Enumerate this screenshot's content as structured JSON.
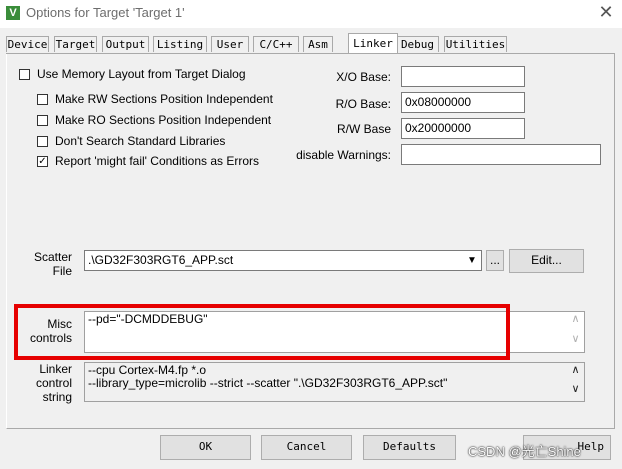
{
  "window": {
    "title": "Options for Target 'Target 1'",
    "icon": "keil-app-icon",
    "close_glyph": "✕"
  },
  "tabs": [
    "Device",
    "Target",
    "Output",
    "Listing",
    "User",
    "C/C++",
    "Asm",
    "Linker",
    "Debug",
    "Utilities"
  ],
  "active_tab": "Linker",
  "options": {
    "use_memory_layout": {
      "label": "Use Memory Layout from Target Dialog",
      "checked": false
    },
    "rw_position_independent": {
      "label": "Make RW Sections Position Independent",
      "checked": false
    },
    "ro_position_independent": {
      "label": "Make RO Sections Position Independent",
      "checked": false
    },
    "dont_search_std_libs": {
      "label": "Don't Search Standard Libraries",
      "checked": false
    },
    "report_might_fail": {
      "label": "Report 'might fail' Conditions as Errors",
      "checked": true,
      "mark": "✓"
    }
  },
  "bases": {
    "xo": {
      "label": "X/O Base:",
      "value": ""
    },
    "ro": {
      "label": "R/O Base:",
      "value": "0x08000000"
    },
    "rw": {
      "label": "R/W Base",
      "value": "0x20000000"
    },
    "disable_warnings": {
      "label": "disable Warnings:",
      "value": ""
    }
  },
  "scatter": {
    "label_line1": "Scatter",
    "label_line2": "File",
    "value": ".\\GD32F303RGT6_APP.sct",
    "browse": "...",
    "edit": "Edit..."
  },
  "misc": {
    "label_line1": "Misc",
    "label_line2": "controls",
    "value": "--pd=\"-DCMDDEBUG\""
  },
  "linker_string": {
    "label_line1": "Linker",
    "label_line2": "control",
    "label_line3": "string",
    "line1": "--cpu Cortex-M4.fp *.o",
    "line2": "--library_type=microlib --strict --scatter \".\\GD32F303RGT6_APP.sct\""
  },
  "buttons": {
    "ok": "OK",
    "cancel": "Cancel",
    "defaults": "Defaults",
    "help": "Help"
  },
  "watermark": "CSDN @光亡Shine",
  "colors": {
    "highlight": "#e60000",
    "dialog_bg": "#f0f0f0",
    "app_icon": "#3a8d3a"
  }
}
